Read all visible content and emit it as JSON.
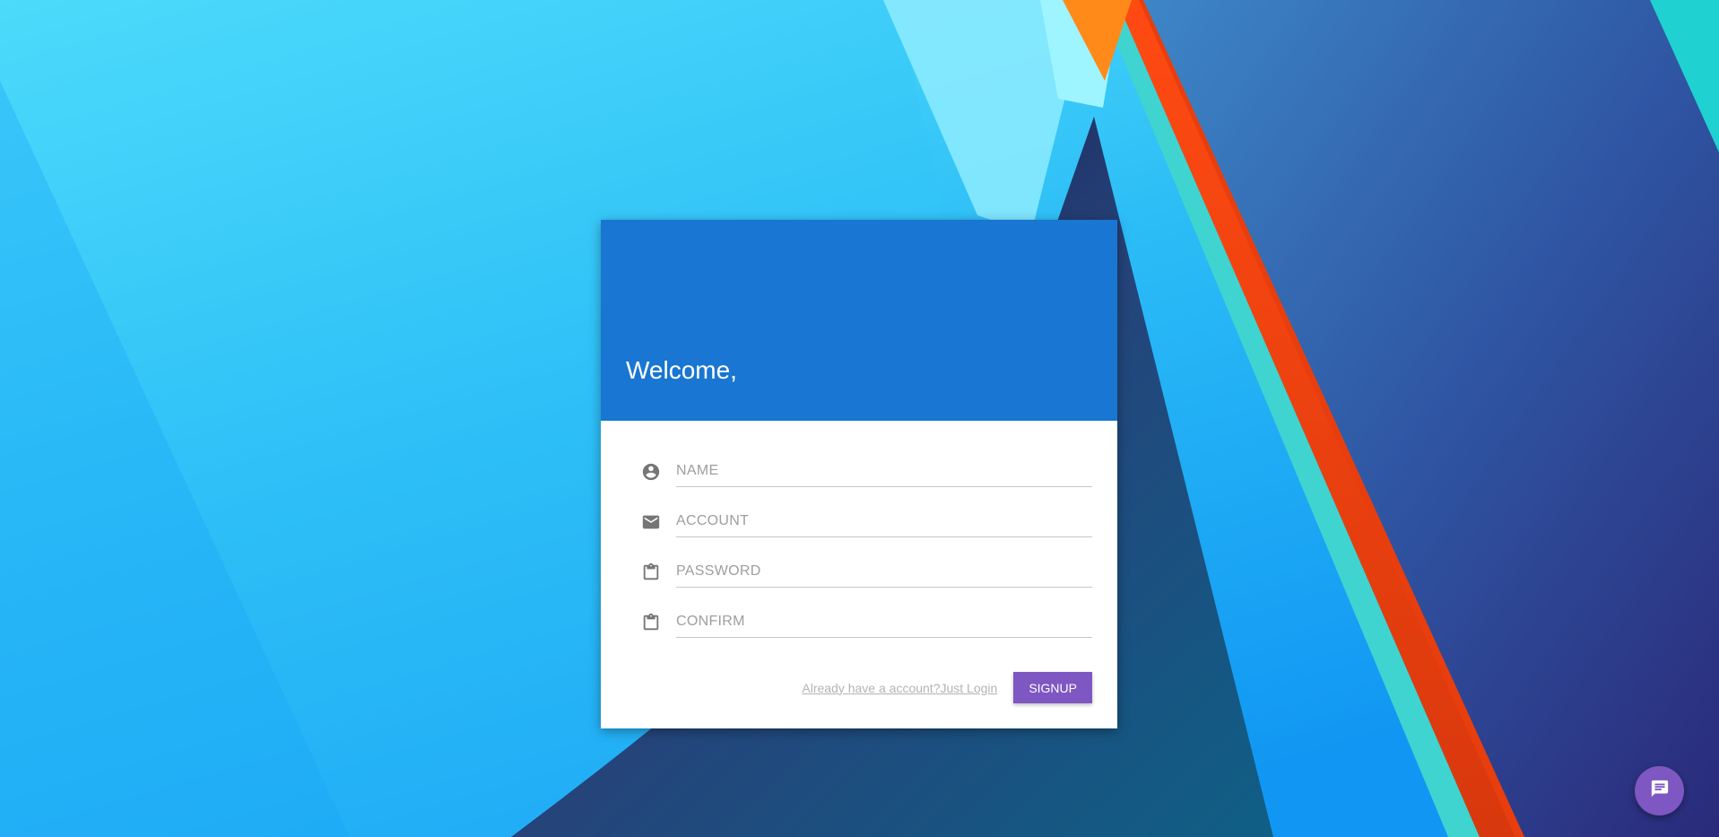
{
  "header": {
    "title": "Welcome,"
  },
  "form": {
    "fields": [
      {
        "placeholder": "NAME",
        "icon": "account-circle-icon"
      },
      {
        "placeholder": "ACCOUNT",
        "icon": "email-icon"
      },
      {
        "placeholder": "PASSWORD",
        "icon": "clipboard-icon"
      },
      {
        "placeholder": "CONFIRM",
        "icon": "clipboard-icon"
      }
    ],
    "login_link": "Already have a account?Just Login",
    "signup_label": "SIGNUP"
  },
  "fab": {
    "icon": "chat-icon"
  },
  "colors": {
    "header_bg": "#1976d2",
    "accent": "#7e57c2",
    "icon": "#757575"
  }
}
